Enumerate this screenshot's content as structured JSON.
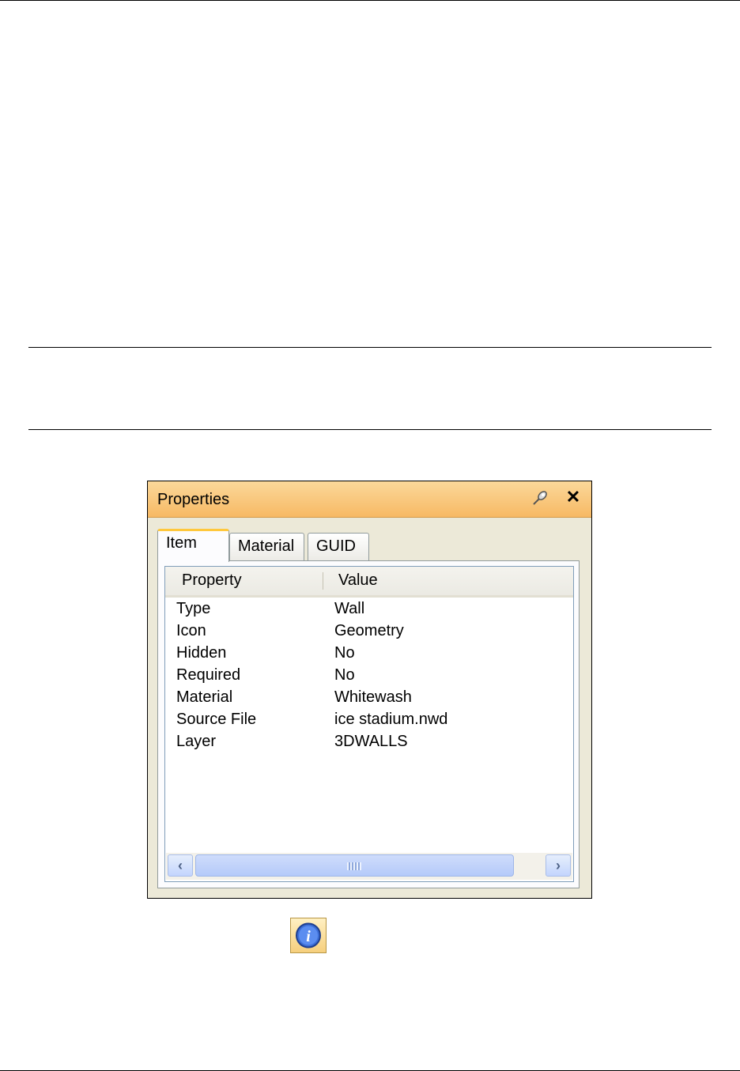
{
  "panel": {
    "title": "Properties",
    "icons": {
      "pin": "pin-icon",
      "close": "close-icon",
      "close_glyph": "✕"
    },
    "tabs": [
      {
        "label": "Item",
        "active": true
      },
      {
        "label": "Material",
        "active": false
      },
      {
        "label": "GUID",
        "active": false
      }
    ],
    "columns": {
      "property": "Property",
      "value": "Value"
    },
    "rows": [
      {
        "property": "Type",
        "value": "Wall"
      },
      {
        "property": "Icon",
        "value": "Geometry"
      },
      {
        "property": "Hidden",
        "value": "No"
      },
      {
        "property": "Required",
        "value": "No"
      },
      {
        "property": "Material",
        "value": "Whitewash"
      },
      {
        "property": "Source File",
        "value": "ice stadium.nwd"
      },
      {
        "property": "Layer",
        "value": "3DWALLS"
      }
    ],
    "scrollbar": {
      "left_glyph": "‹",
      "right_glyph": "›"
    }
  },
  "info_icon": {
    "name": "info-icon",
    "glyph": "i"
  },
  "colors": {
    "title_bar": "#f7b964",
    "tab_highlight": "#ffc83c",
    "scroll_thumb": "#b5cafa",
    "info_icon_fill": "#f6cf7d"
  }
}
